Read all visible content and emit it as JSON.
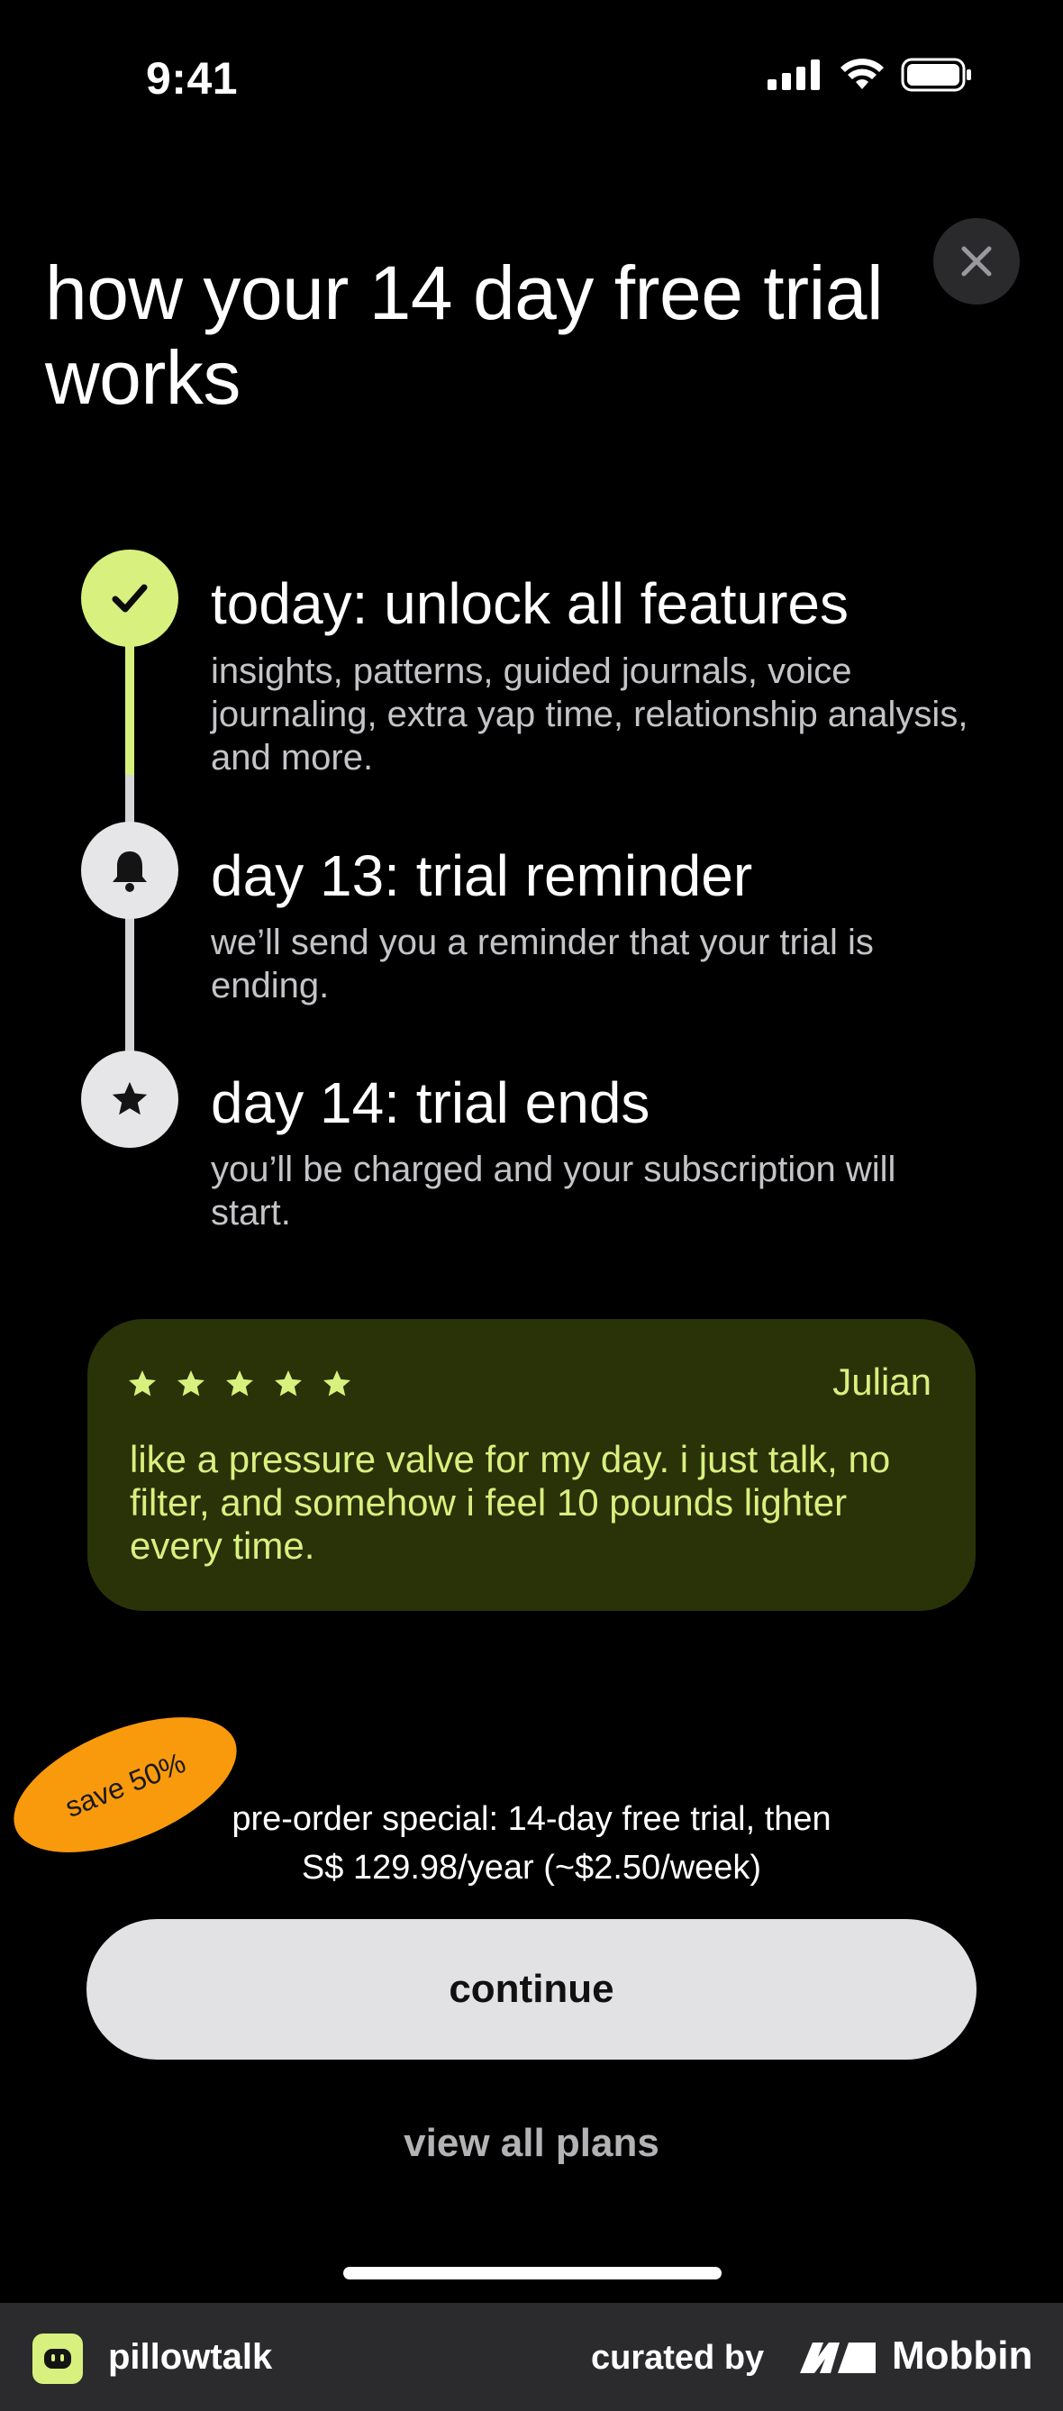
{
  "status_bar": {
    "time": "9:41",
    "icons": [
      "cellular-signal-icon",
      "wifi-icon",
      "battery-icon"
    ]
  },
  "header": {
    "title": "how your 14 day free trial works",
    "close_icon": "close-icon"
  },
  "timeline": {
    "steps": [
      {
        "title": "today: unlock all features",
        "description": "insights, patterns, guided journals, voice journaling, extra yap time, relationship analysis, and more.",
        "icon": "checkmark-icon"
      },
      {
        "title": "day 13: trial reminder",
        "description": "we’ll send you a reminder that your trial is ending.",
        "icon": "bell-icon"
      },
      {
        "title": "day 14: trial ends",
        "description": "you’ll be charged and your subscription will start.",
        "icon": "star-icon"
      }
    ],
    "progress_fraction": 0.5
  },
  "review": {
    "rating": 5,
    "rating_max": 5,
    "reviewer": "Julian",
    "text": "like a pressure valve for my day. i just talk, no filter, and somehow i feel 10 pounds lighter every time."
  },
  "offer": {
    "badge": "save 50%",
    "line1": "pre-order special: 14-day free trial, then",
    "line2": "S$ 129.98/year (~$2.50/week)"
  },
  "actions": {
    "continue_label": "continue",
    "view_plans_label": "view all plans"
  },
  "footer": {
    "app_name": "pillowtalk",
    "curated_by": "curated by",
    "brand": "Mobbin"
  },
  "colors": {
    "background": "#000000",
    "accent": "#d8f07e",
    "review_bg": "#2a3208",
    "badge": "#f99a0d",
    "button": "#e2e1e4"
  }
}
